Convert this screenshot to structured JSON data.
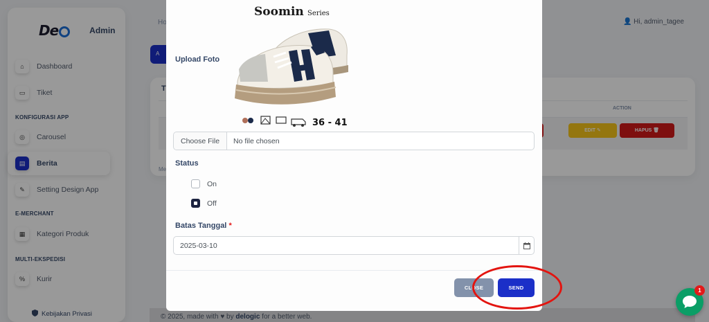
{
  "sidebar": {
    "brand_logo": "De",
    "brand_name": "Admin",
    "items": [
      {
        "label": "Dashboard"
      },
      {
        "label": "Tiket"
      },
      {
        "label": "Carousel"
      },
      {
        "label": "Berita"
      },
      {
        "label": "Setting Design App"
      },
      {
        "label": "Kategori Produk"
      },
      {
        "label": "Kurir"
      }
    ],
    "headings": [
      "KONFIGURASI APP",
      "E-MERCHANT",
      "MULTI-EKSPEDISI"
    ],
    "footer_label": "Kebijakan Privasi"
  },
  "header": {
    "breadcrumb": "Ho",
    "user_greeting": "Hi, admin_tagee"
  },
  "background_page": {
    "add_button_label": "A",
    "card_title": "T",
    "column_action": "ACTION",
    "edit_label": "EDIT ✎",
    "hapus_label": "HAPUS 🗑",
    "page_info": "Me",
    "footer": {
      "prefix": "© 2025, made with",
      "by": "by",
      "brand": "delogic",
      "suffix": "for a better web."
    }
  },
  "modal": {
    "upload_label": "Upload Foto",
    "product_image": {
      "brand": "Soomin",
      "brand_suffix": "Series",
      "size_range": "36 - 41"
    },
    "file_button": "Choose File",
    "file_status": "No file chosen",
    "status_label": "Status",
    "status_options": [
      {
        "label": "On",
        "checked": false
      },
      {
        "label": "Off",
        "checked": true
      }
    ],
    "date_label": "Batas Tanggal",
    "date_required_mark": "*",
    "date_value": "2025-03-10",
    "close_label": "CLOSE",
    "send_label": "SEND"
  },
  "chat_widget": {
    "badge_count": "1"
  },
  "colors": {
    "primary": "#1b2fc8",
    "annotation": "#e3140f",
    "warning": "#f7c51a",
    "danger": "#d21a1a",
    "chat": "#0a9e66"
  }
}
